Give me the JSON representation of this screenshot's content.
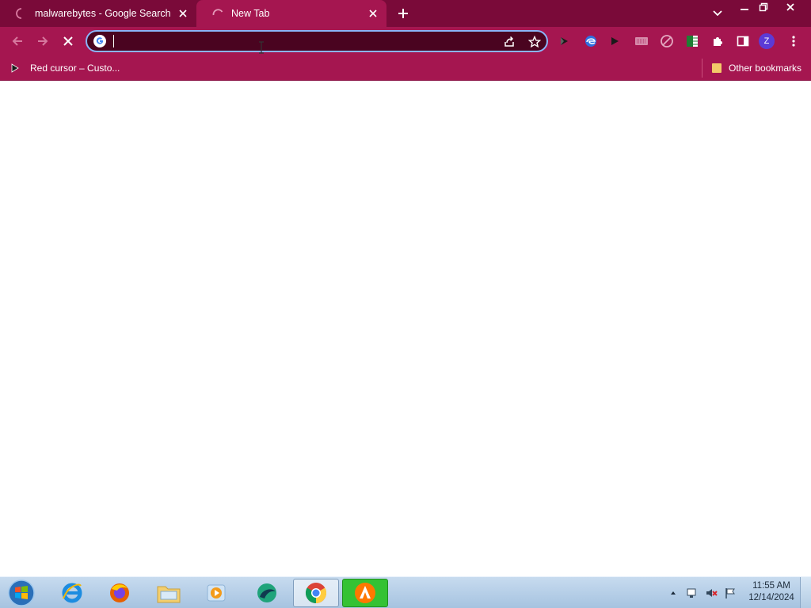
{
  "browser": {
    "tabs": [
      {
        "title": "malwarebytes - Google Search",
        "loading": true,
        "active": false
      },
      {
        "title": "New Tab",
        "loading": true,
        "active": true
      }
    ],
    "omnibox": {
      "value": "",
      "placeholder": ""
    },
    "extensions": [
      "play-extension-icon",
      "edge-extension-icon",
      "cursor-extension-icon",
      "keyboard-extension-icon",
      "block-extension-icon",
      "sheets-extension-icon",
      "puzzle-extensions-icon",
      "side-panel-icon"
    ],
    "profile_initial": "Z",
    "bookmarks": [
      {
        "label": "Red cursor – Custo..."
      }
    ],
    "other_bookmarks": "Other bookmarks",
    "colors": {
      "tabstrip": "#7a0a39",
      "toolbar": "#a51650",
      "omnibox": "#4a0420",
      "focus_ring": "#8ab4f8",
      "profile": "#5b3bd6"
    }
  },
  "taskbar": {
    "apps": [
      "internet-explorer",
      "firefox",
      "file-explorer",
      "media-player",
      "maps-app",
      "chrome",
      "avast"
    ],
    "clock": {
      "time": "11:55 AM",
      "date": "12/14/2024"
    }
  }
}
